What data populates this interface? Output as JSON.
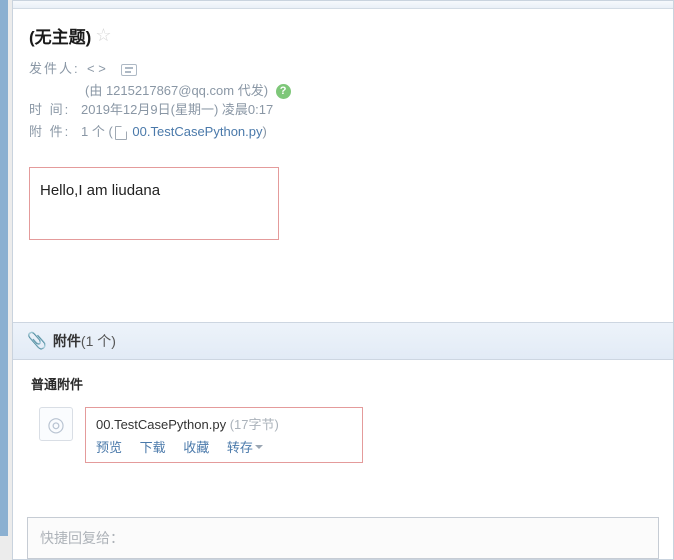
{
  "subject": "(无主题)",
  "meta": {
    "sender_label": "发件人:",
    "sender_brackets": "<  >",
    "proxy_prefix": "(由 ",
    "proxy_email": "1215217867@qq.com",
    "proxy_suffix": " 代发)",
    "time_label": "时    间:",
    "time_value": "2019年12月9日(星期一) 凌晨0:17",
    "attach_label": "附    件:",
    "attach_count_text": "1 个",
    "attach_file_link": "00.TestCasePython.py"
  },
  "body_text": "Hello,I am liudana",
  "attachments": {
    "section_title": "附件",
    "section_count": "(1 个)",
    "normal_label": "普通附件",
    "file": {
      "name": "00.TestCasePython.py",
      "size": "(17字节)"
    },
    "actions": {
      "preview": "预览",
      "download": "下载",
      "favorite": "收藏",
      "forward": "转存"
    }
  },
  "quick_reply_placeholder": "快捷回复给："
}
